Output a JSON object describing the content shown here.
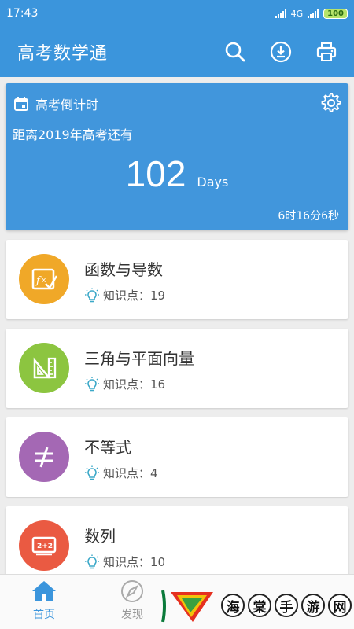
{
  "status_bar": {
    "time": "17:43",
    "network": "4G",
    "battery": "100"
  },
  "app_bar": {
    "title": "高考数学通"
  },
  "countdown": {
    "heading": "高考倒计时",
    "subtitle": "距离2019年高考还有",
    "days": "102",
    "days_unit": "Days",
    "timer": "6时16分6秒"
  },
  "topics": [
    {
      "name": "函数与导数",
      "knowledge_label": "知识点：19",
      "color": "#f0a828",
      "icon": "function-icon"
    },
    {
      "name": "三角与平面向量",
      "knowledge_label": "知识点：16",
      "color": "#8cc540",
      "icon": "ruler-triangle-icon"
    },
    {
      "name": "不等式",
      "knowledge_label": "知识点：4",
      "color": "#a468b4",
      "icon": "not-equal-icon"
    },
    {
      "name": "数列",
      "knowledge_label": "知识点：10",
      "color": "#ea5a42",
      "icon": "board-icon"
    }
  ],
  "bottom_nav": {
    "home": {
      "label": "首页",
      "color": "#3b95dc"
    },
    "discover": {
      "label": "发现",
      "color": "#999999"
    }
  },
  "watermark": {
    "text": "海棠手游网",
    "chars": [
      "海",
      "棠",
      "手",
      "游",
      "网"
    ]
  }
}
